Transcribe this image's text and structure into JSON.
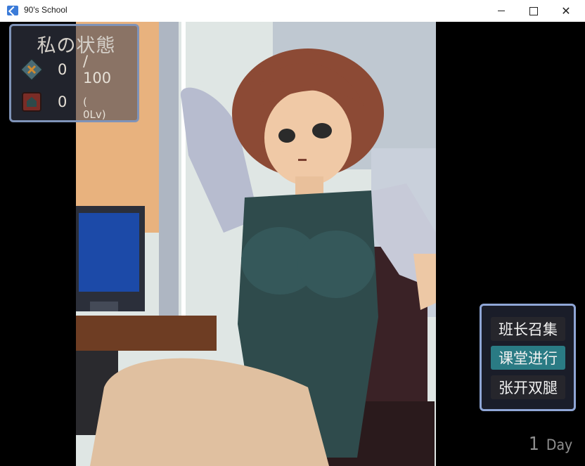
{
  "window": {
    "title": "90's School",
    "minimize_label": "—",
    "maximize_label": "□",
    "close_label": "✕"
  },
  "status": {
    "title": "私の状態",
    "stat1_value": "0",
    "stat1_max": "/ 100",
    "stat2_value": "0",
    "stat2_level": "( 0Lv)"
  },
  "menu": {
    "items": [
      {
        "label": "班长召集"
      },
      {
        "label": "课堂进行"
      },
      {
        "label": "张开双腿"
      }
    ],
    "selected_index": 1
  },
  "day": {
    "number": "1",
    "label": "Day"
  },
  "colors": {
    "menu_border": "#8fa6d6",
    "menu_selected": "#2a7b84",
    "status_border": "#7f93b8"
  }
}
